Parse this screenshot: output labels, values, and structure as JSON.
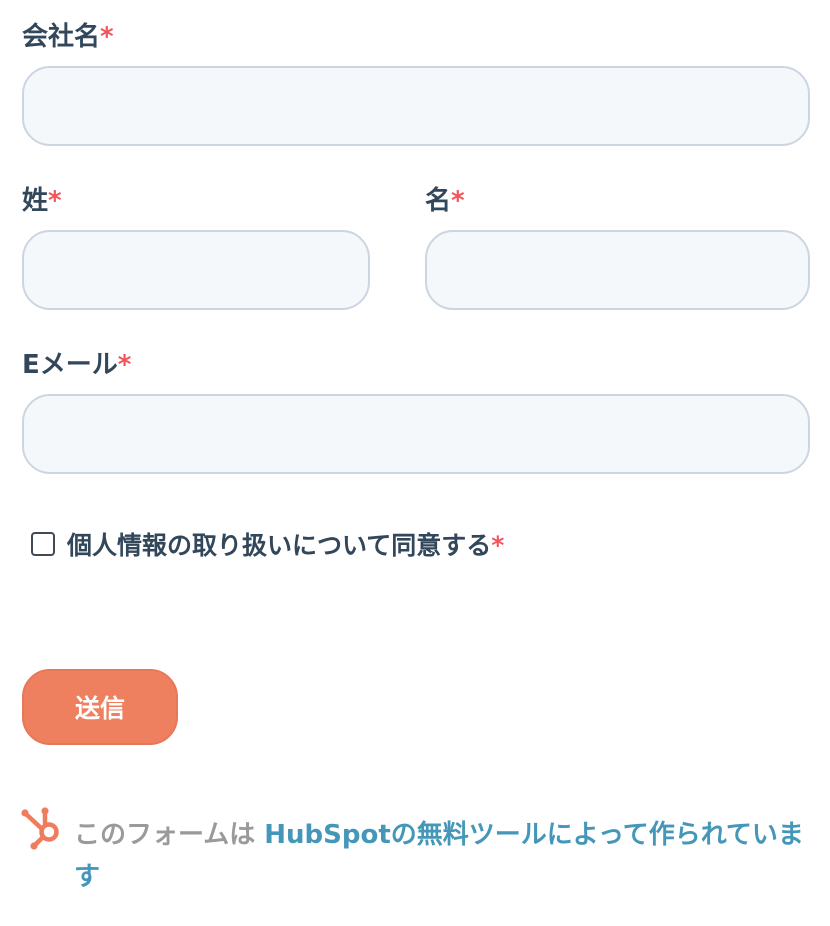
{
  "form": {
    "company": {
      "label": "会社名",
      "required_mark": "*",
      "value": "",
      "placeholder": ""
    },
    "last_name": {
      "label": "姓",
      "required_mark": "*",
      "value": "",
      "placeholder": ""
    },
    "first_name": {
      "label": "名",
      "required_mark": "*",
      "value": "",
      "placeholder": ""
    },
    "email": {
      "label": "Eメール",
      "required_mark": "*",
      "value": "",
      "placeholder": ""
    },
    "consent": {
      "label": "個人情報の取り扱いについて同意する",
      "required_mark": "*",
      "checked": false
    },
    "submit_label": "送信"
  },
  "footer": {
    "icon": "hubspot-sprocket-icon",
    "static_text": "このフォームは ",
    "link_text": "HubSpotの無料ツールによって作られています"
  },
  "colors": {
    "required": "#f2545b",
    "submit_bg": "#ee8060",
    "link": "#4497b8",
    "field_bg": "#f5f8fa",
    "field_border": "#cbd6e2",
    "hubspot_orange": "#ef7c5c"
  }
}
